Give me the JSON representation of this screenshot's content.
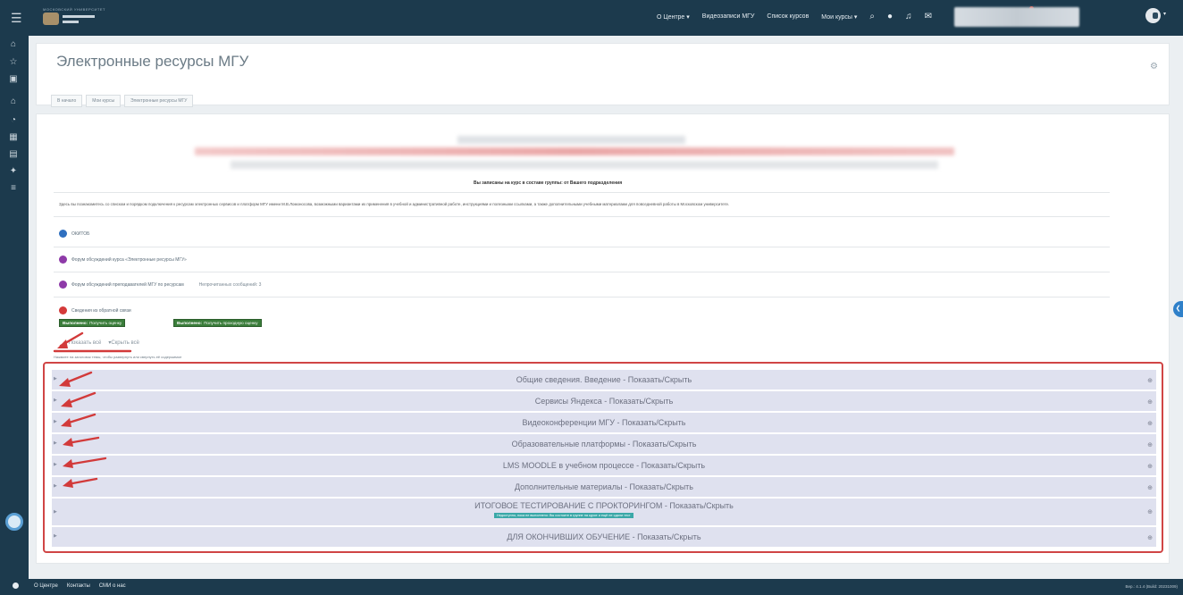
{
  "topbar": {
    "logo_caption": "МОСКОВСКИЙ УНИВЕРСИТЕТ",
    "nav": [
      {
        "label": "О Центре",
        "caret": true
      },
      {
        "label": "Видеозаписи МГУ",
        "caret": false
      },
      {
        "label": "Список курсов",
        "caret": false
      },
      {
        "label": "Мои курсы",
        "caret": true
      }
    ]
  },
  "header": {
    "title": "Электронные ресурсы МГУ",
    "breadcrumbs": [
      "В начало",
      "Мои курсы",
      "Электронные ресурсы МГУ"
    ]
  },
  "main": {
    "welcome": "Вы записаны на курс в составе группы: от Вашего подразделения",
    "intro": "Здесь вы познакомитесь со списком и порядком подключения к ресурсам электронных сервисов и платформ МГУ имени М.В.Ломоносова, возможными вариантами их применения в учебной и административной работе, инструкциями и полезными ссылками, а также дополнительными учебными материалами для повседневной работы в Московском университете.",
    "activities": [
      {
        "label": "ОКИТОБ",
        "extra": "",
        "color": "#2f6fbf"
      },
      {
        "label": "Форум обсуждений курса «Электронные ресурсы МГУ»",
        "extra": "",
        "color": "#8e3aa8"
      },
      {
        "label": "Форум обсуждений преподавателей МГУ по ресурсам",
        "extra": "Непрочитанных сообщений: 3",
        "color": "#8e3aa8"
      },
      {
        "label": "Сведения из обратной связи",
        "extra": "",
        "color": "#d43a3a"
      }
    ],
    "completion_badges": [
      {
        "bold": "Выполнено:",
        "text": "Получить оценку"
      },
      {
        "bold": "Выполнено:",
        "text": "Получить проходную оценку"
      }
    ],
    "show_all": "Показать всё",
    "hide_all": "Скрыть всё",
    "toggle_note": "Нажмите на заголовок темы, чтобы развернуть или свернуть её содержимое"
  },
  "sections": [
    {
      "title": "Общие сведения. Введение - Показать/Скрыть",
      "badge": ""
    },
    {
      "title": "Сервисы Яндекса - Показать/Скрыть",
      "badge": ""
    },
    {
      "title": "Видеоконференции МГУ - Показать/Скрыть",
      "badge": ""
    },
    {
      "title": "Образовательные платформы - Показать/Скрыть",
      "badge": ""
    },
    {
      "title": "LMS MOODLE в учебном процессе - Показать/Скрыть",
      "badge": ""
    },
    {
      "title": "Дополнительные материалы - Показать/Скрыть",
      "badge": ""
    },
    {
      "title": "ИТОГОВОЕ ТЕСТИРОВАНИЕ С ПРОКТОРИНГОМ - Показать/Скрыть",
      "badge": "Недоступно, пока не выполнено: Вы состоите в группе на курсе и ещё не сдали тест"
    },
    {
      "title": "ДЛЯ ОКОНЧИВШИХ ОБУЧЕНИЕ - Показать/Скрыть",
      "badge": ""
    }
  ],
  "footer": {
    "links": [
      "О Центре",
      "Контакты",
      "СМИ о нас"
    ],
    "version": "Вер.: 4.1.4 (Build: 20231009)"
  },
  "icons": {
    "menu": "menu-icon",
    "search": "search-icon",
    "globe": "globe-icon",
    "bell": "bell-icon",
    "messages": "message-icon",
    "settings": "gear-icon"
  },
  "colors": {
    "navbar": "#1c3a4d",
    "section_bg": "#dfe1ef",
    "highlight_border": "#d04545",
    "badge_green": "#3a7d3a"
  }
}
